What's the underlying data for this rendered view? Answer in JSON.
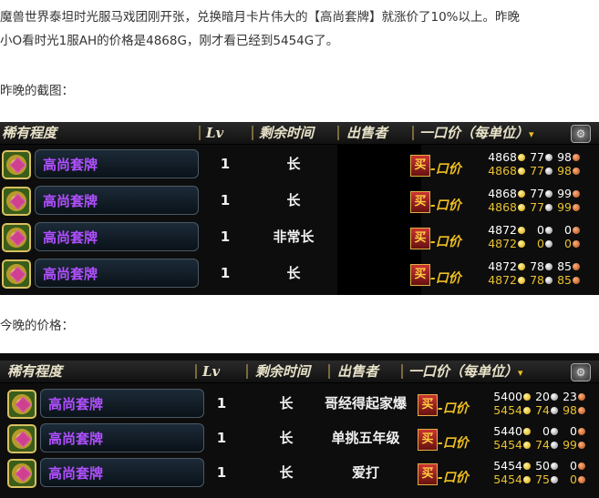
{
  "intro": {
    "line1": "魔兽世界泰坦时光服马戏团刚开张，兑换暗月卡片伟大的【高尚套牌】就涨价了10%以上。昨晚",
    "line2": "小O看时光1服AH的价格是4868G，刚才看已经到5454G了。"
  },
  "caption_last_night": "昨晚的截图：",
  "caption_tonight": "今晚的价格：",
  "header": {
    "rarity": "稀有程度",
    "lv": "Lv",
    "time_left": "剩余时间",
    "seller": "出售者",
    "buyout": "一口价（每单位）",
    "sort_arrow": "▾",
    "gear_icon": "gear-icon"
  },
  "buy_label": "买",
  "buyout_short": "-口价",
  "panel1": {
    "rows": [
      {
        "name": "高尚套牌",
        "lv": "1",
        "time": "长",
        "seller": "",
        "unit": [
          "4868",
          "77",
          "98"
        ],
        "total": [
          "4868",
          "77",
          "98"
        ]
      },
      {
        "name": "高尚套牌",
        "lv": "1",
        "time": "长",
        "seller": "",
        "unit": [
          "4868",
          "77",
          "99"
        ],
        "total": [
          "4868",
          "77",
          "99"
        ]
      },
      {
        "name": "高尚套牌",
        "lv": "1",
        "time": "非常长",
        "seller": "",
        "unit": [
          "4872",
          "0",
          "0"
        ],
        "total": [
          "4872",
          "0",
          "0"
        ]
      },
      {
        "name": "高尚套牌",
        "lv": "1",
        "time": "长",
        "seller": "",
        "unit": [
          "4872",
          "78",
          "85"
        ],
        "total": [
          "4872",
          "78",
          "85"
        ]
      }
    ]
  },
  "panel2": {
    "rows": [
      {
        "name": "高尚套牌",
        "lv": "1",
        "time": "长",
        "seller": "哥经得起家爆",
        "unit": [
          "5400",
          "20",
          "23"
        ],
        "total": [
          "5454",
          "74",
          "98"
        ]
      },
      {
        "name": "高尚套牌",
        "lv": "1",
        "time": "长",
        "seller": "单挑五年级",
        "unit": [
          "5440",
          "0",
          "0"
        ],
        "total": [
          "5454",
          "74",
          "99"
        ]
      },
      {
        "name": "高尚套牌",
        "lv": "1",
        "time": "长",
        "seller": "爱打",
        "unit": [
          "5454",
          "50",
          "0"
        ],
        "total": [
          "5454",
          "75",
          "0"
        ]
      }
    ]
  }
}
